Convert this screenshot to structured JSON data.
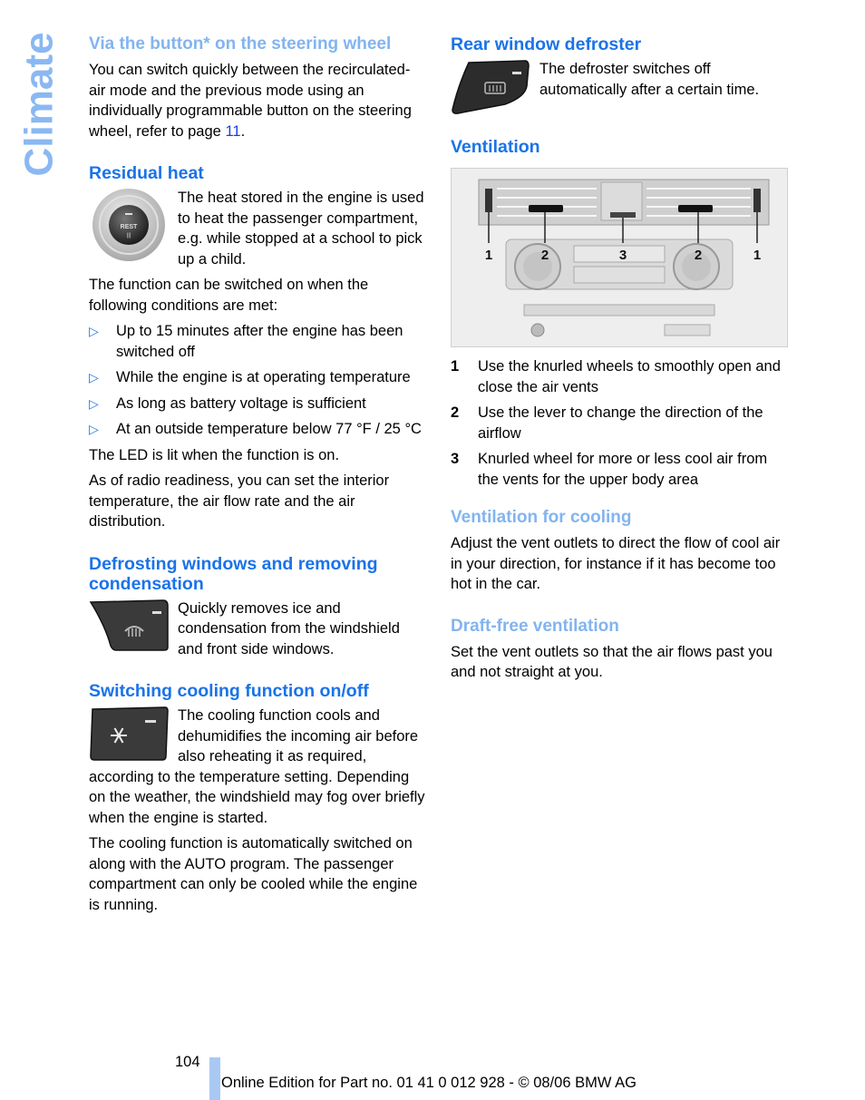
{
  "side_title": "Climate",
  "left": {
    "steering": {
      "heading": "Via the button* on the steering wheel",
      "text": "You can switch quickly between the recirculated-air mode and the previous mode using an individually programmable button on the steering wheel, refer to page ",
      "link": "11",
      "text_end": "."
    },
    "residual": {
      "heading": "Residual heat",
      "image_label": "REST",
      "intro": "The heat stored in the engine is used to heat the passenger compartment, e.g. while stopped at a school to pick up a child.",
      "conditions_intro": "The function can be switched on when the following conditions are met:",
      "conditions": [
        "Up to 15 minutes after the engine has been switched off",
        "While the engine is at operating temperature",
        "As long as battery voltage is sufficient",
        "At an outside temperature below 77 °F / 25 °C"
      ],
      "led": "The LED is lit when the function is on.",
      "radio": "As of radio readiness, you can set the interior temperature, the air flow rate and the air distribution."
    },
    "defrost": {
      "heading": "Defrosting windows and removing condensation",
      "text": "Quickly removes ice and condensation from the windshield and front side windows."
    },
    "cooling": {
      "heading": "Switching cooling function on/off",
      "text": "The cooling function cools and dehumidifies the incoming air before also reheating it as required, according to the temperature setting. Depending on the weather, the windshield may fog over briefly when the engine is started.",
      "auto": "The cooling function is automatically switched on along with the AUTO program. The passenger compartment can only be cooled while the engine is running."
    }
  },
  "right": {
    "rear": {
      "heading": "Rear window defroster",
      "text": "The defroster switches off automatically after a certain time."
    },
    "ventilation": {
      "heading": "Ventilation",
      "figure_labels": [
        "1",
        "2",
        "3",
        "2",
        "1"
      ],
      "items": [
        {
          "n": "1",
          "text": "Use the knurled wheels to smoothly open and close the air vents"
        },
        {
          "n": "2",
          "text": "Use the lever to change the direction of the airflow"
        },
        {
          "n": "3",
          "text": "Knurled wheel for more or less cool air from the vents for the upper body area"
        }
      ]
    },
    "cooling_vent": {
      "heading": "Ventilation for cooling",
      "text": "Adjust the vent outlets to direct the flow of cool air in your direction, for instance if it has become too hot in the car."
    },
    "draft": {
      "heading": "Draft-free ventilation",
      "text": "Set the vent outlets so that the air flows past you and not straight at you."
    }
  },
  "footer": {
    "page_number": "104",
    "edition": "Online Edition for Part no. 01 41 0 012 928 - © 08/06 BMW AG"
  }
}
